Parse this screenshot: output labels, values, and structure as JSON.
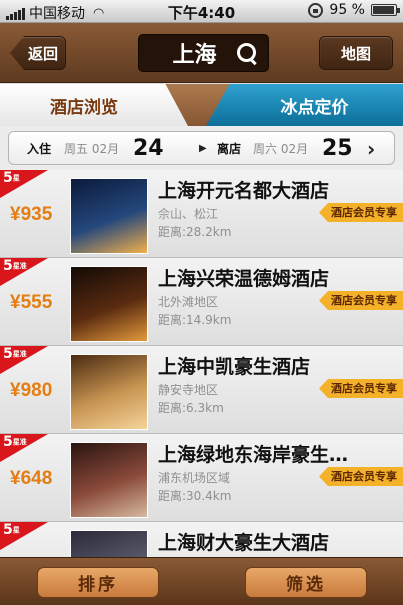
{
  "status_bar": {
    "carrier": "中国移动",
    "time": "下午4:40",
    "battery_text": "95 %",
    "battery_level": 0.95
  },
  "nav": {
    "back_label": "返回",
    "city": "上海",
    "map_label": "地图"
  },
  "tabs": [
    {
      "label": "酒店浏览",
      "active": true
    },
    {
      "label": "冰点定价",
      "active": false
    }
  ],
  "dates": {
    "checkin_label": "入住",
    "checkin_weekday_month": "周五 02月",
    "checkin_day": "24",
    "checkout_label": "离店",
    "checkout_weekday_month": "周六 02月",
    "checkout_day": "25"
  },
  "hotels": [
    {
      "star": "5",
      "star_suffix": "星",
      "price": "¥935",
      "name": "上海开元名都大酒店",
      "area": "佘山、松江",
      "distance": "距离:28.2km",
      "badge": "酒店会员专享",
      "thumb_colors": [
        "#0b1b3a",
        "#24477c",
        "#f2b04a"
      ]
    },
    {
      "star": "5",
      "star_suffix": "星准",
      "price": "¥555",
      "name": "上海兴荣温德姆酒店",
      "area": "北外滩地区",
      "distance": "距离:14.9km",
      "badge": "酒店会员专享",
      "thumb_colors": [
        "#120a06",
        "#5a2b10",
        "#e39a3b"
      ]
    },
    {
      "star": "5",
      "star_suffix": "星准",
      "price": "¥980",
      "name": "上海中凯豪生酒店",
      "area": "静安寺地区",
      "distance": "距离:6.3km",
      "badge": "酒店会员专享",
      "thumb_colors": [
        "#4a2a10",
        "#c89552",
        "#f4d49a"
      ]
    },
    {
      "star": "5",
      "star_suffix": "星准",
      "price": "¥648",
      "name": "上海绿地东海岸豪生…",
      "area": "浦东机场区域",
      "distance": "距离:30.4km",
      "badge": "酒店会员专享",
      "thumb_colors": [
        "#2a1410",
        "#8a4a3a",
        "#d7b9a0"
      ]
    },
    {
      "star": "5",
      "star_suffix": "星",
      "price": "",
      "name": "上海财大豪生大酒店",
      "area": "",
      "distance": "",
      "badge": "",
      "thumb_colors": [
        "#2a2a3a",
        "#5a5a6a",
        "#a0a0b0"
      ]
    }
  ],
  "bottom": {
    "sort_label": "排序",
    "filter_label": "筛选"
  }
}
